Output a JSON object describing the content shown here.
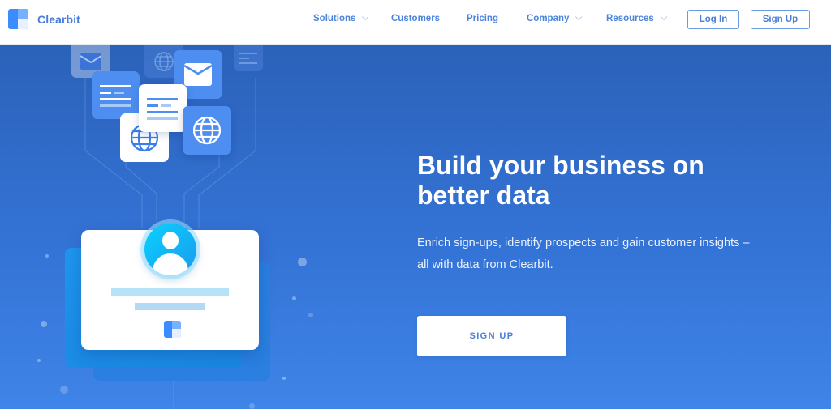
{
  "brand": {
    "name": "Clearbit",
    "logo_icon": "clearbit-logo-icon",
    "accent_color": "#4a7ed8"
  },
  "nav": {
    "items": [
      {
        "label": "Solutions",
        "has_dropdown": true
      },
      {
        "label": "Customers",
        "has_dropdown": false
      },
      {
        "label": "Pricing",
        "has_dropdown": false
      },
      {
        "label": "Company",
        "has_dropdown": true
      },
      {
        "label": "Resources",
        "has_dropdown": true
      }
    ],
    "login_label": "Log In",
    "signup_label": "Sign Up"
  },
  "hero": {
    "headline": "Build your business on better data",
    "subtext": "Enrich sign-ups, identify prospects and gain customer insights – all with data from Clearbit.",
    "cta_label": "SIGN UP",
    "background_top": "#2b62b9",
    "background_bottom": "#3f84e8"
  },
  "illustration": {
    "tiles": [
      "mail-icon",
      "document-icon",
      "globe-icon",
      "mail-icon",
      "document-icon",
      "globe-icon",
      "globe-icon",
      "document-icon"
    ],
    "profile_card": {
      "avatar_icon": "user-avatar-icon",
      "logo_icon": "clearbit-logo-icon"
    }
  }
}
